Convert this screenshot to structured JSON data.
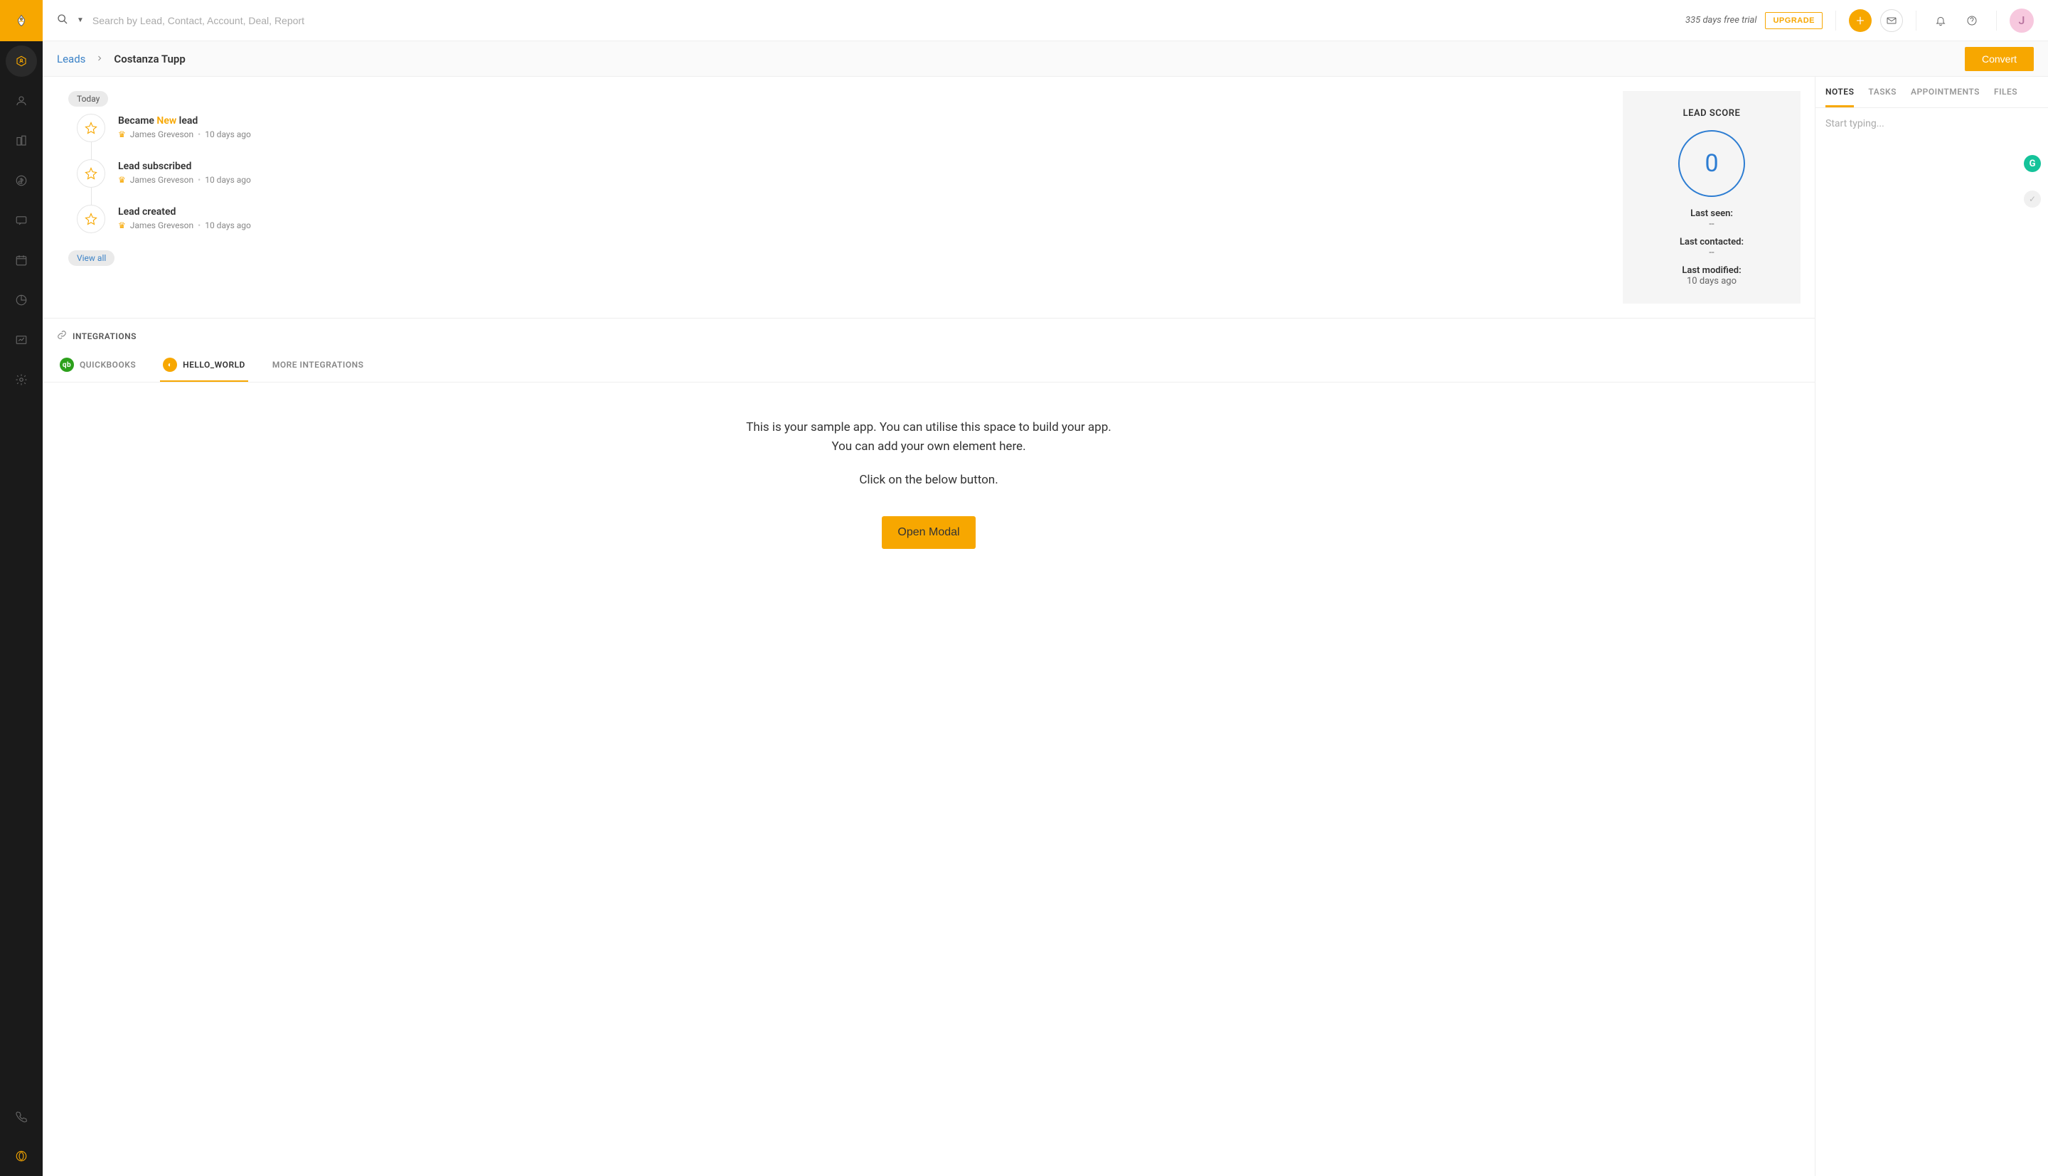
{
  "header": {
    "search_placeholder": "Search by Lead, Contact, Account, Deal, Report",
    "trial_text": "335 days free trial",
    "upgrade_label": "UPGRADE",
    "avatar_letter": "J"
  },
  "breadcrumb": {
    "parent": "Leads",
    "current": "Costanza Tupp",
    "convert_label": "Convert"
  },
  "timeline": {
    "today_chip": "Today",
    "view_all": "View all",
    "items": [
      {
        "title_pre": "Became ",
        "title_tag": "New",
        "title_post": " lead",
        "author": "James Greveson",
        "time": "10 days ago"
      },
      {
        "title_pre": "Lead subscribed",
        "title_tag": "",
        "title_post": "",
        "author": "James Greveson",
        "time": "10 days ago"
      },
      {
        "title_pre": "Lead created",
        "title_tag": "",
        "title_post": "",
        "author": "James Greveson",
        "time": "10 days ago"
      }
    ]
  },
  "score": {
    "title": "LEAD SCORE",
    "value": "0",
    "last_seen_label": "Last seen:",
    "last_seen_value": "--",
    "last_contacted_label": "Last contacted:",
    "last_contacted_value": "--",
    "last_modified_label": "Last modified:",
    "last_modified_value": "10 days ago"
  },
  "integrations": {
    "header": "INTEGRATIONS",
    "tabs": {
      "quickbooks": "QUICKBOOKS",
      "hello_world": "HELLO_WORLD",
      "more": "MORE INTEGRATIONS"
    },
    "body_line1": "This is your sample app. You can utilise this space to build your app.",
    "body_line2": "You can add your own element here.",
    "body_line3": "Click on the below button.",
    "button": "Open Modal"
  },
  "right_panel": {
    "tabs": {
      "notes": "NOTES",
      "tasks": "TASKS",
      "appointments": "APPOINTMENTS",
      "files": "FILES"
    },
    "notes_placeholder": "Start typing...",
    "badge": "G",
    "check": "✓"
  }
}
